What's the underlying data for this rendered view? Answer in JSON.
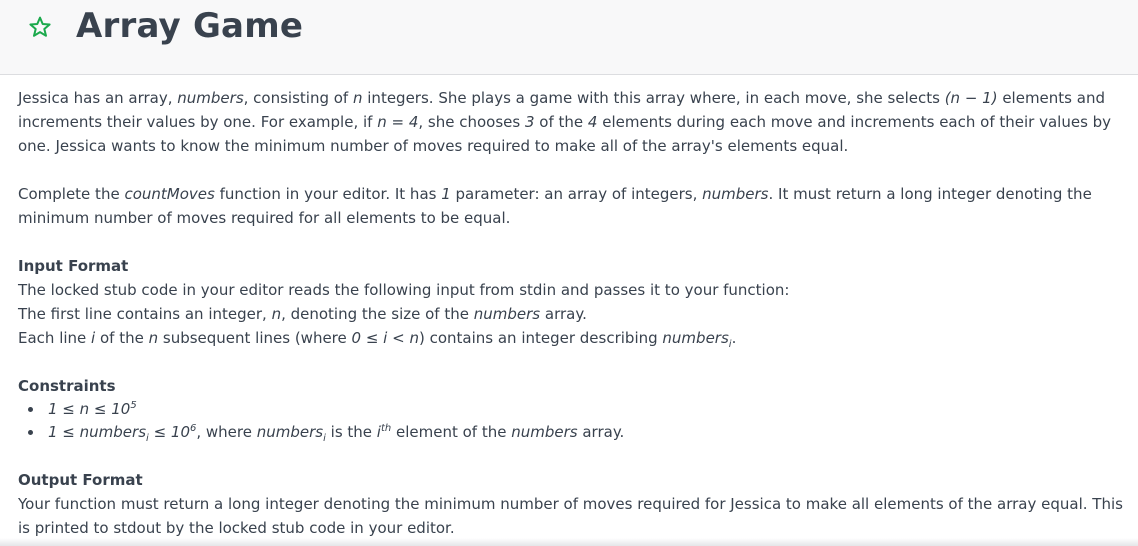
{
  "header": {
    "title": "Array Game",
    "star_icon": "star-outline-icon",
    "accent_color": "#1ba94c"
  },
  "statement": {
    "p1": {
      "a": "Jessica has an array, ",
      "b": "numbers",
      "c": ", consisting of ",
      "d": "n",
      "e": " integers. She plays a game with this array where, in each move, she selects ",
      "f": "(n − 1)",
      "g": " elements and increments their values by one. For example, if ",
      "h": "n = 4",
      "i": ", she chooses ",
      "j": "3",
      "k": " of the ",
      "l": "4",
      "m": " elements during each move and increments each of their values by one. Jessica wants to know the minimum number of moves required to make all of the array's elements equal."
    },
    "p2": {
      "a": "Complete the ",
      "b": "countMoves",
      "c": " function in your editor. It has ",
      "d": "1",
      "e": " parameter: an array of integers, ",
      "f": "numbers",
      "g": ". It must return a long integer denoting the minimum number of moves required for all elements to be equal."
    }
  },
  "input_format": {
    "title": "Input Format",
    "line1": "The locked stub code in your editor reads the following input from stdin and passes it to your function:",
    "line2": {
      "a": "The first line contains an integer, ",
      "b": "n",
      "c": ", denoting the size of the ",
      "d": "numbers",
      "e": " array."
    },
    "line3": {
      "a": "Each line ",
      "b": "i",
      "c": " of the ",
      "d": "n",
      "e": " subsequent lines (where ",
      "f": "0 ≤ i < n",
      "g": ") contains an integer describing ",
      "h": "numbers",
      "i": "i",
      "j": "."
    }
  },
  "constraints": {
    "title": "Constraints",
    "c1": {
      "a": "1 ≤ n ≤ 10",
      "b": "5"
    },
    "c2": {
      "a": "1 ≤ numbers",
      "b": "i",
      "c": " ≤ 10",
      "d": "6",
      "e": ", where ",
      "f": "numbers",
      "g": "i",
      "h": " is the ",
      "i": "i",
      "j": "th",
      "k": " element of the ",
      "l": "numbers",
      "m": " array."
    }
  },
  "output_format": {
    "title": "Output Format",
    "text": "Your function must return a long integer denoting the minimum number of moves required for Jessica to make all elements of the array equal. This is printed to stdout by the locked stub code in your editor."
  }
}
